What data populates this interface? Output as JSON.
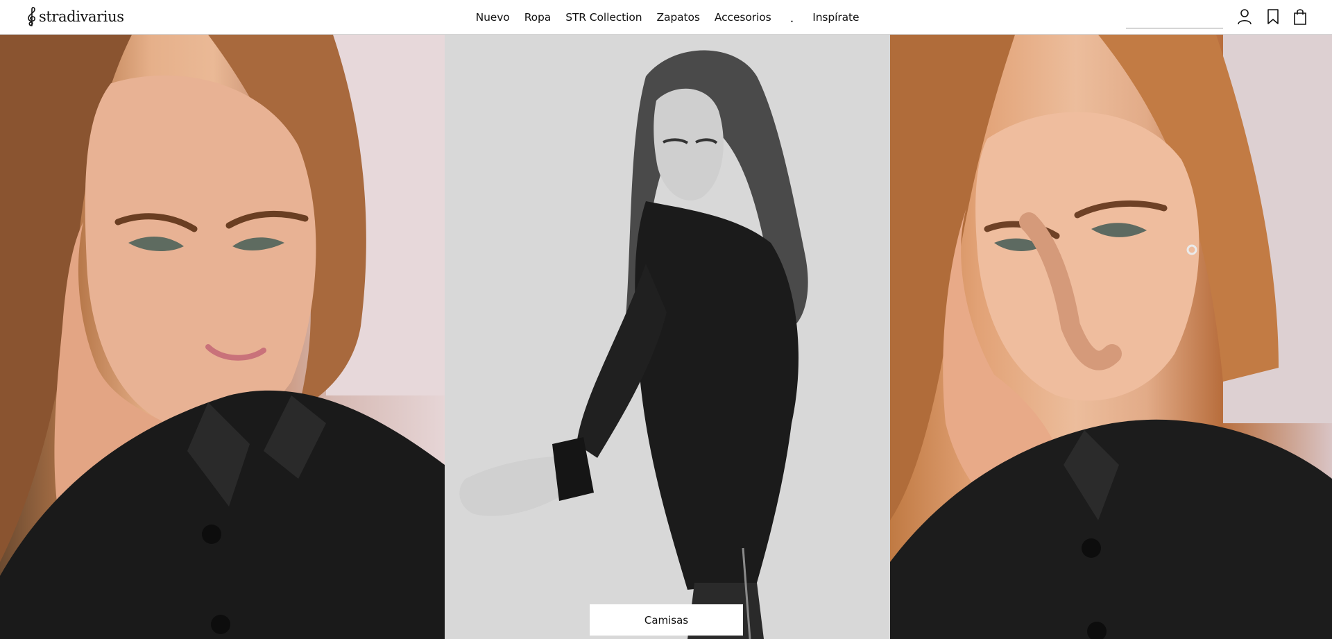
{
  "brand": {
    "name": "stradivarius",
    "logo_icon": "treble-clef-icon"
  },
  "nav": {
    "items": [
      "Nuevo",
      "Ropa",
      "STR Collection",
      "Zapatos",
      "Accesorios"
    ],
    "separator": ".",
    "extra": "Inspírate"
  },
  "search": {
    "value": "",
    "placeholder": "",
    "icon": "search-icon"
  },
  "header_icons": [
    "user-icon",
    "bookmark-icon",
    "shopping-bag-icon"
  ],
  "hero": {
    "panels": [
      {
        "description_icon": "model-photo-left"
      },
      {
        "description_icon": "model-photo-center-bw"
      },
      {
        "description_icon": "model-photo-right"
      }
    ],
    "cta_label": "Camisas"
  },
  "colors": {
    "header_bg": "#ffffff",
    "text": "#111111",
    "cta_bg": "#ffffff"
  }
}
